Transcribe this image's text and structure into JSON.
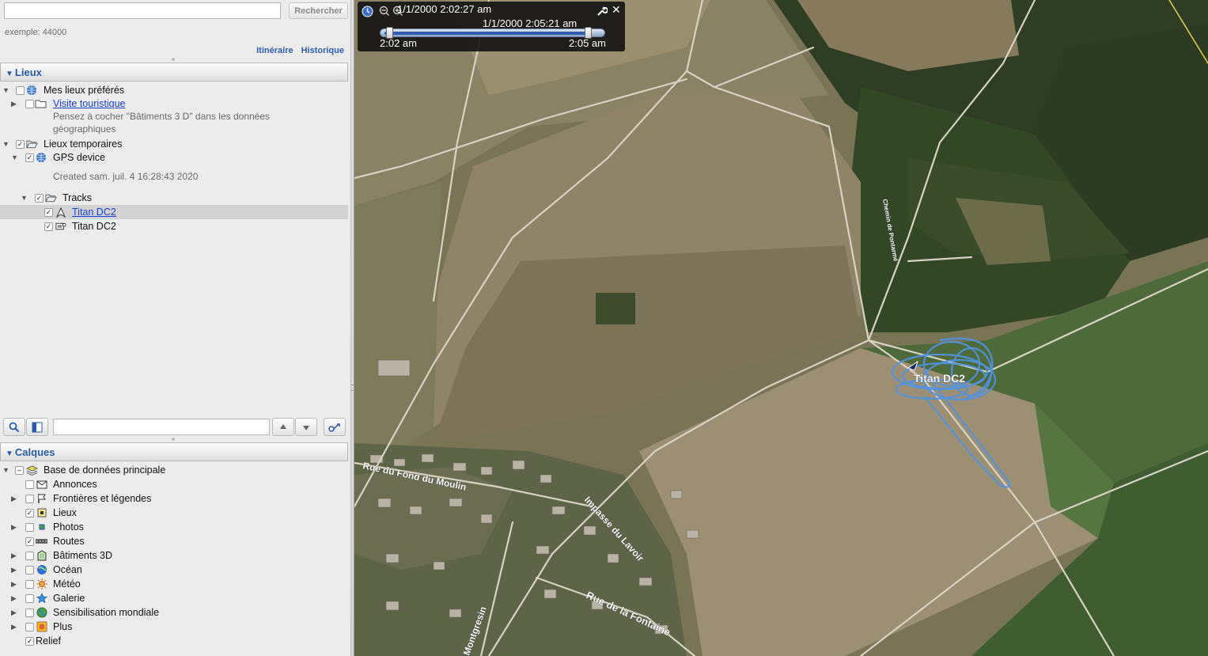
{
  "search": {
    "placeholder": "",
    "button": "Rechercher",
    "hint": "exemple: 44000"
  },
  "links": {
    "itinerary": "Itinéraire",
    "history": "Historique"
  },
  "places": {
    "header": "Lieux",
    "items": [
      {
        "label": "Mes lieux préférés"
      },
      {
        "label": "Visite touristique",
        "desc": "Pensez à cocher \"Bâtiments 3 D\" dans les données géographiques"
      },
      {
        "label": "Lieux temporaires"
      },
      {
        "label": "GPS device",
        "desc": "Created sam. juil. 4 16:28:43 2020"
      },
      {
        "label": "Tracks"
      },
      {
        "label": "Titan DC2"
      },
      {
        "label": "Titan DC2"
      }
    ]
  },
  "layers": {
    "header": "Calques",
    "items": [
      {
        "label": "Base de données principale"
      },
      {
        "label": "Annonces"
      },
      {
        "label": "Frontières et légendes"
      },
      {
        "label": "Lieux"
      },
      {
        "label": "Photos"
      },
      {
        "label": "Routes"
      },
      {
        "label": "Bâtiments 3D"
      },
      {
        "label": "Océan"
      },
      {
        "label": "Météo"
      },
      {
        "label": "Galerie"
      },
      {
        "label": "Sensibilisation mondiale"
      },
      {
        "label": "Plus"
      },
      {
        "label": "Relief"
      }
    ]
  },
  "timeslider": {
    "start_time": "1/1/2000   2:02:27 am",
    "current_time": "1/1/2000   2:05:21 am",
    "min_label": "2:02 am",
    "max_label": "2:05 am"
  },
  "map": {
    "track_label": "Titan DC2",
    "streets": [
      "Rue du Fond du Moulin",
      "Impasse du Lavoir",
      "Rue de la Fontaine",
      "Montgresin",
      "Chemin de Pontarmé"
    ]
  },
  "colors": {
    "accent": "#2b5aa8",
    "link": "#1a3fd4",
    "track": "#4f94e6"
  }
}
